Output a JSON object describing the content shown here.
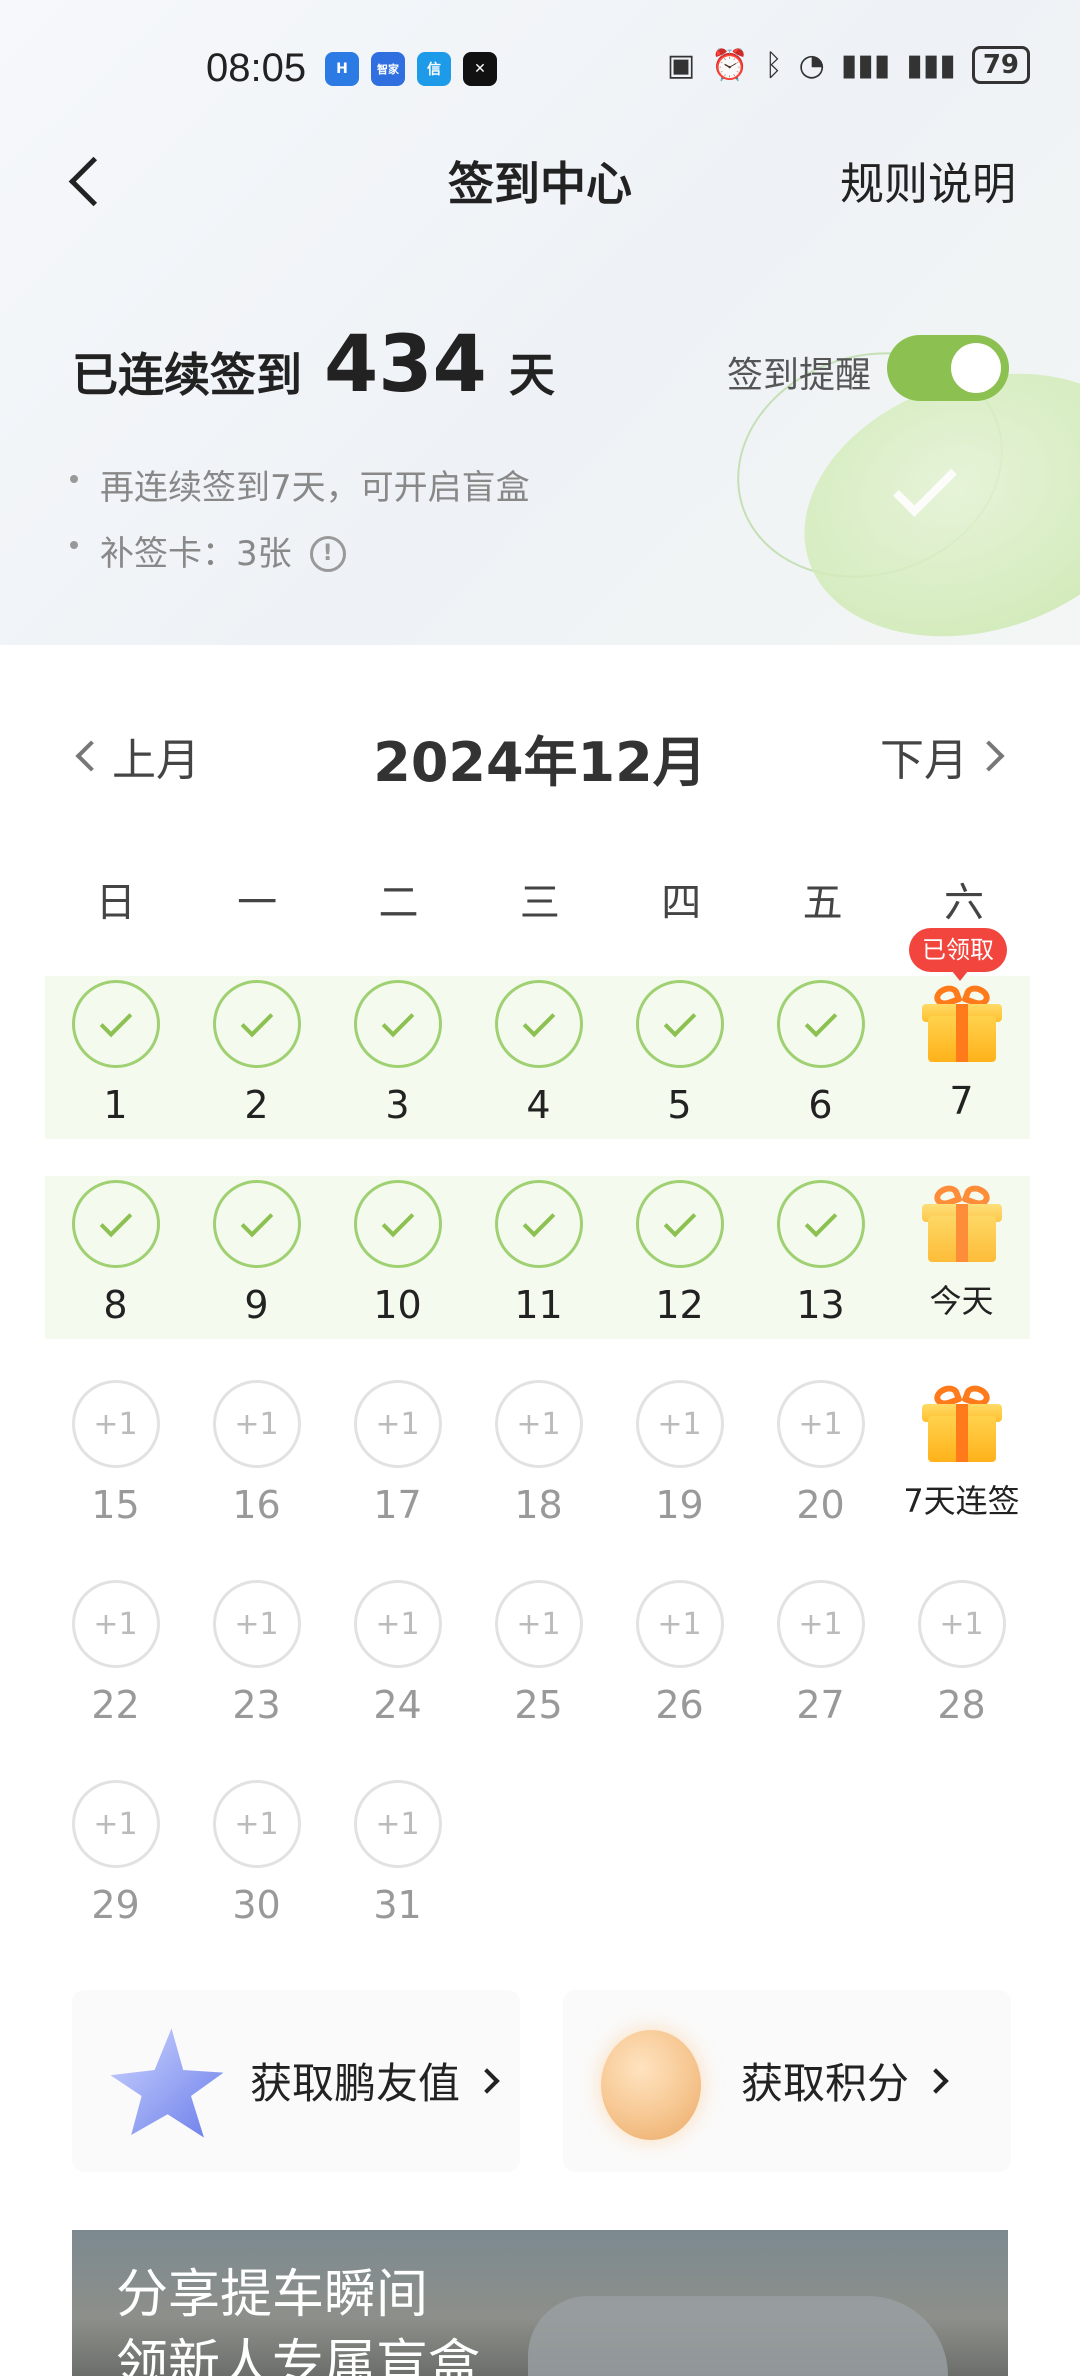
{
  "status_bar": {
    "time": "08:05",
    "app_icons": [
      {
        "name": "app-icon-1",
        "label": "H",
        "color": "#2c7be5"
      },
      {
        "name": "app-icon-2",
        "label": "智家",
        "color": "#2f6fe0"
      },
      {
        "name": "app-icon-3",
        "label": "信",
        "color": "#1e9be8"
      },
      {
        "name": "app-icon-4",
        "label": "✕",
        "color": "#111111"
      }
    ],
    "battery": "79"
  },
  "nav": {
    "title": "签到中心",
    "rules_label": "规则说明"
  },
  "streak": {
    "prefix": "已连续签到",
    "days": "434",
    "suffix": "天"
  },
  "reminder": {
    "label": "签到提醒",
    "enabled": true
  },
  "bullets": {
    "line1": "再连续签到7天，可开启盲盒",
    "line2": "补签卡：3张"
  },
  "month_nav": {
    "prev": "上月",
    "title": "2024年12月",
    "next": "下月"
  },
  "weekdays": [
    "日",
    "一",
    "二",
    "三",
    "四",
    "五",
    "六"
  ],
  "calendar": {
    "claimed_badge": "已领取",
    "checked_days": [
      "1",
      "2",
      "3",
      "4",
      "5",
      "6",
      "8",
      "9",
      "10",
      "11",
      "12",
      "13"
    ],
    "gift_day_7": "7",
    "gift_today": "今天",
    "gift_streak": "7天连签",
    "future_mark": "+1",
    "future_days": [
      "15",
      "16",
      "17",
      "18",
      "19",
      "20",
      "22",
      "23",
      "24",
      "25",
      "26",
      "27",
      "28",
      "29",
      "30",
      "31"
    ]
  },
  "cards": {
    "friend_value": "获取鹏友值",
    "points": "获取积分"
  },
  "banner": {
    "line1": "分享提车瞬间",
    "line2": "领新人专属盲盒"
  },
  "colors": {
    "accent_green": "#8cc152",
    "badge_red": "#f2453d",
    "gift_orange": "#ffb21a"
  }
}
